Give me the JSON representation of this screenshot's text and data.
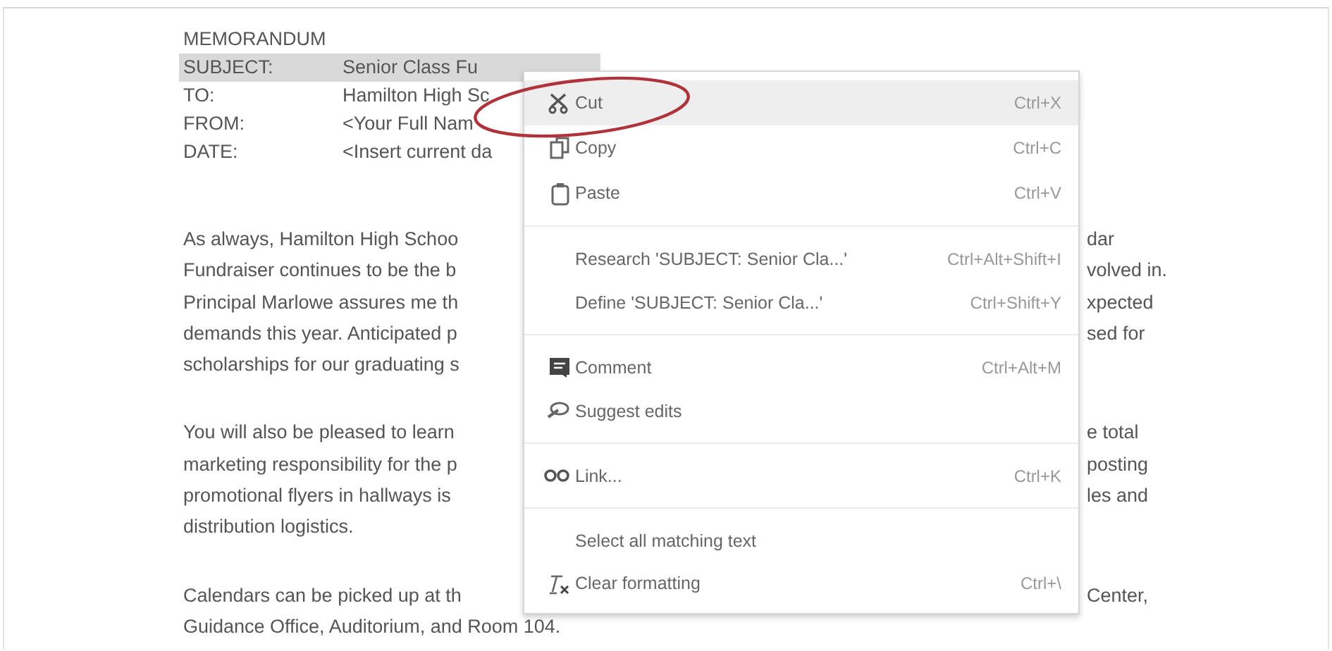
{
  "memo": {
    "title": "MEMORANDUM",
    "header": [
      {
        "label": "SUBJECT:",
        "value": "Senior Class Fu",
        "selected": true
      },
      {
        "label": "TO:",
        "value": "Hamilton High Sc",
        "selected": false
      },
      {
        "label": "FROM:",
        "value": "<Your Full Nam",
        "selected": false
      },
      {
        "label": "DATE:",
        "value": "<Insert current da",
        "selected": false
      }
    ],
    "paragraphs": [
      [
        {
          "left": "As always, Hamilton High Schoo",
          "right": "dar"
        },
        {
          "left": "Fundraiser continues to be the b",
          "right": "volved in."
        },
        {
          "left": "Principal Marlowe assures me th",
          "right": "xpected"
        },
        {
          "left": "demands this year. Anticipated p",
          "right": "sed for"
        },
        {
          "left": "scholarships for our graduating s"
        }
      ],
      [
        {
          "left": "You will also be pleased to learn",
          "right": "e total"
        },
        {
          "left": "marketing responsibility for the p",
          "right": "posting"
        },
        {
          "left": "promotional flyers in hallways is",
          "right": "les and"
        },
        {
          "left": "distribution logistics."
        }
      ],
      [
        {
          "left": "Calendars can be picked up at th",
          "right": "Center,"
        },
        {
          "left": "Guidance Office, Auditorium, and Room 104."
        }
      ]
    ]
  },
  "context_menu": {
    "groups": [
      [
        {
          "kind": "cut",
          "label": "Cut",
          "shortcut": "Ctrl+X",
          "selected": true
        },
        {
          "kind": "copy",
          "label": "Copy",
          "shortcut": "Ctrl+C",
          "selected": false
        },
        {
          "kind": "paste",
          "label": "Paste",
          "shortcut": "Ctrl+V",
          "selected": false
        }
      ],
      [
        {
          "kind": "plain",
          "label": "Research 'SUBJECT: Senior Cla...'",
          "shortcut": "Ctrl+Alt+Shift+I",
          "selected": false
        },
        {
          "kind": "plain",
          "label": "Define 'SUBJECT: Senior Cla...'",
          "shortcut": "Ctrl+Shift+Y",
          "selected": false
        }
      ],
      [
        {
          "kind": "comment",
          "label": "Comment",
          "shortcut": "Ctrl+Alt+M",
          "selected": false
        },
        {
          "kind": "suggest",
          "label": "Suggest edits",
          "selected": false
        }
      ],
      [
        {
          "kind": "link",
          "label": "Link...",
          "shortcut": "Ctrl+K",
          "selected": false
        }
      ],
      [
        {
          "kind": "plain",
          "label": "Select all matching text",
          "selected": false
        },
        {
          "kind": "clear",
          "label": "Clear formatting",
          "shortcut": "Ctrl+\\",
          "selected": false
        }
      ]
    ]
  }
}
